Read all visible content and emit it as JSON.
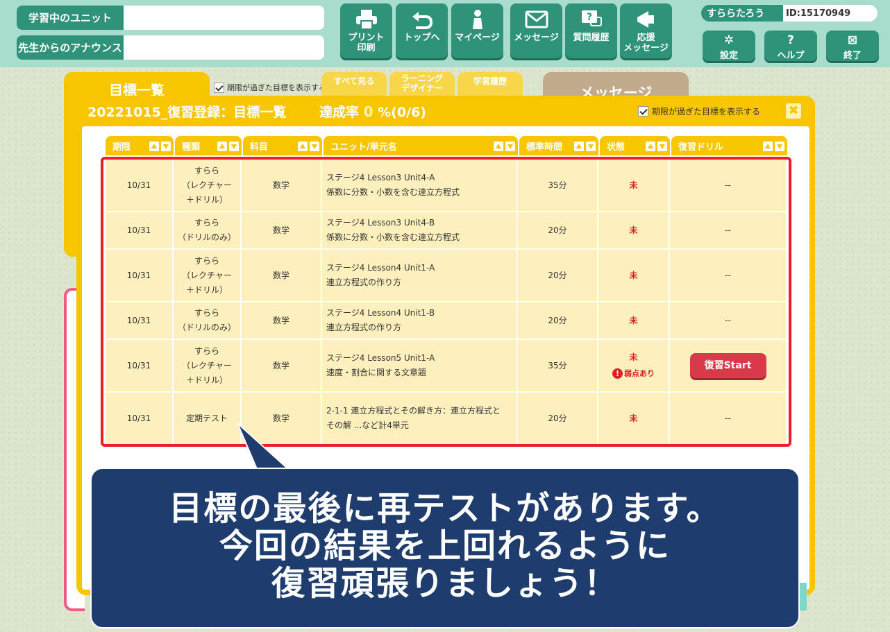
{
  "header": {
    "unit_label": "学習中のユニット",
    "announce_label": "先生からのアナウンス",
    "buttons": [
      {
        "label": "プリント\n印刷",
        "icon": "printer-icon"
      },
      {
        "label": "トップへ",
        "icon": "back-arrow-icon"
      },
      {
        "label": "マイページ",
        "icon": "person-icon"
      },
      {
        "label": "メッセージ",
        "icon": "envelope-icon"
      },
      {
        "label": "質問履歴",
        "icon": "question-bubble-icon"
      },
      {
        "label": "応援\nメッセージ",
        "icon": "megaphone-icon"
      }
    ],
    "user_name": "すららたろう",
    "user_id": "ID:15170949",
    "settings_label": "設定",
    "help_label": "ヘルプ",
    "exit_label": "終了"
  },
  "back": {
    "goals_title": "目標一覧",
    "show_expired": "期限が過ぎた目標を表示する",
    "tabs": [
      "すべて見る",
      "ラーニング\nデザイナー",
      "学習履歴"
    ],
    "message_title": "メッセージ"
  },
  "panel": {
    "title": "20221015_復習登録：目標一覧",
    "rate_label": "達成率",
    "rate_value": "0",
    "rate_suffix": "%(0/6)",
    "show_expired": "期限が過ぎた目標を表示する",
    "close": "✖"
  },
  "table": {
    "headers": [
      "期限",
      "種類",
      "科目",
      "ユニット/単元名",
      "標準時間",
      "状態",
      "復習ドリル"
    ],
    "rows": [
      {
        "deadline": "10/31",
        "type": "すらら\n（レクチャー\n＋ドリル）",
        "subject": "数学",
        "unit": "ステージ4 Lesson3 Unit4-A\n係数に分数・小数を含む連立方程式",
        "time": "35分",
        "status": "未",
        "weak": "",
        "drill": "--"
      },
      {
        "deadline": "10/31",
        "type": "すらら\n（ドリルのみ）",
        "subject": "数学",
        "unit": "ステージ4 Lesson3 Unit4-B\n係数に分数・小数を含む連立方程式",
        "time": "20分",
        "status": "未",
        "weak": "",
        "drill": "--"
      },
      {
        "deadline": "10/31",
        "type": "すらら\n（レクチャー\n＋ドリル）",
        "subject": "数学",
        "unit": "ステージ4 Lesson4 Unit1-A\n連立方程式の作り方",
        "time": "20分",
        "status": "未",
        "weak": "",
        "drill": "--"
      },
      {
        "deadline": "10/31",
        "type": "すらら\n（ドリルのみ）",
        "subject": "数学",
        "unit": "ステージ4 Lesson4 Unit1-B\n連立方程式の作り方",
        "time": "20分",
        "status": "未",
        "weak": "",
        "drill": "--"
      },
      {
        "deadline": "10/31",
        "type": "すらら\n（レクチャー\n＋ドリル）",
        "subject": "数学",
        "unit": "ステージ4 Lesson5 Unit1-A\n速度・割合に関する文章題",
        "time": "35分",
        "status": "未",
        "weak": "弱点あり",
        "drill": "復習Start"
      },
      {
        "deadline": "10/31",
        "type": "定期テスト",
        "subject": "数学",
        "unit": "2-1-1 連立方程式とその解き方：連立方程式と\nその解 ...など計4単元",
        "time": "20分",
        "status": "未",
        "weak": "",
        "drill": "--"
      }
    ]
  },
  "callout": {
    "line1": "目標の最後に再テストがあります。",
    "line2": "今回の結果を上回れるように",
    "line3": "復習頑張りましょう！"
  },
  "colors": {
    "accent": "#f7c600",
    "header_green": "#2e9379",
    "highlight_red": "#ee1c24",
    "callout_navy": "#1e3d6e"
  }
}
